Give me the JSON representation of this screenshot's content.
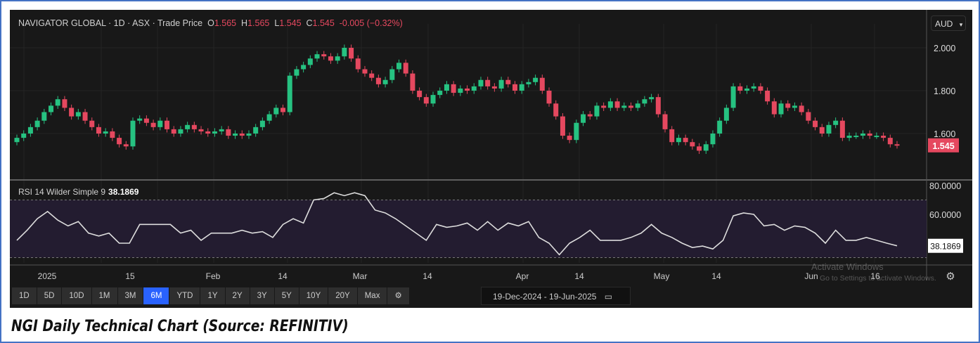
{
  "header": {
    "title": "NAVIGATOR GLOBAL · 1D · ASX · Trade Price",
    "o_label": "O",
    "o": "1.565",
    "h_label": "H",
    "h": "1.565",
    "l_label": "L",
    "l": "1.545",
    "c_label": "C",
    "c": "1.545",
    "change": "-0.005 (−0.32%)"
  },
  "currency": "AUD",
  "colors": {
    "up": "#26c281",
    "down": "#e5485f",
    "bg": "#181818",
    "active": "#2962ff"
  },
  "chart_data": [
    {
      "type": "candlestick",
      "title": "NAVIGATOR GLOBAL · 1D · ASX · Trade Price",
      "ylim": [
        1.42,
        2.08
      ],
      "y_ticks": [
        "2.000",
        "1.800",
        "1.600"
      ],
      "last_price": "1.545",
      "first_open": 1.56,
      "closes": [
        1.58,
        1.6,
        1.63,
        1.66,
        1.7,
        1.73,
        1.76,
        1.72,
        1.68,
        1.7,
        1.66,
        1.63,
        1.6,
        1.61,
        1.58,
        1.55,
        1.54,
        1.66,
        1.67,
        1.65,
        1.63,
        1.66,
        1.62,
        1.6,
        1.62,
        1.64,
        1.62,
        1.61,
        1.6,
        1.61,
        1.62,
        1.59,
        1.6,
        1.59,
        1.6,
        1.63,
        1.66,
        1.69,
        1.72,
        1.7,
        1.87,
        1.9,
        1.92,
        1.95,
        1.97,
        1.96,
        1.94,
        1.96,
        2.0,
        1.95,
        1.9,
        1.88,
        1.86,
        1.83,
        1.85,
        1.9,
        1.93,
        1.88,
        1.8,
        1.77,
        1.74,
        1.78,
        1.8,
        1.83,
        1.79,
        1.81,
        1.8,
        1.82,
        1.85,
        1.82,
        1.81,
        1.85,
        1.83,
        1.8,
        1.83,
        1.84,
        1.86,
        1.8,
        1.74,
        1.68,
        1.59,
        1.57,
        1.65,
        1.69,
        1.68,
        1.73,
        1.72,
        1.75,
        1.72,
        1.73,
        1.72,
        1.74,
        1.76,
        1.77,
        1.69,
        1.62,
        1.56,
        1.58,
        1.56,
        1.54,
        1.52,
        1.55,
        1.6,
        1.66,
        1.72,
        1.82,
        1.8,
        1.81,
        1.82,
        1.8,
        1.75,
        1.69,
        1.74,
        1.72,
        1.73,
        1.7,
        1.66,
        1.63,
        1.6,
        1.64,
        1.66,
        1.58,
        1.59,
        1.59,
        1.6,
        1.59,
        1.59,
        1.58,
        1.55,
        1.545
      ]
    },
    {
      "type": "line",
      "title": "RSI 14 Wilder Simple 9",
      "current": "38.1869",
      "ylim": [
        22,
        82
      ],
      "y_ticks": [
        "80.0000",
        "60.0000"
      ],
      "bands": [
        70,
        30
      ],
      "values": [
        42,
        49,
        57,
        62,
        56,
        52,
        55,
        47,
        45,
        47,
        40,
        40,
        53,
        53,
        53,
        53,
        47,
        49,
        42,
        47,
        47,
        47,
        49,
        47,
        48,
        44,
        53,
        57,
        54,
        70,
        71,
        75,
        73,
        75,
        73,
        63,
        61,
        57,
        52,
        47,
        42,
        53,
        51,
        52,
        54,
        49,
        55,
        49,
        54,
        52,
        55,
        44,
        40,
        32,
        40,
        44,
        49,
        42,
        42,
        42,
        44,
        47,
        53,
        47,
        44,
        40,
        37,
        38,
        36,
        42,
        59,
        61,
        60,
        52,
        53,
        49,
        52,
        51,
        47,
        40,
        49,
        42,
        42,
        44,
        42,
        40,
        38.2
      ]
    }
  ],
  "x_axis": [
    "2025",
    "15",
    "Feb",
    "14",
    "Mar",
    "14",
    "Apr",
    "14",
    "May",
    "14",
    "Jun",
    "16"
  ],
  "ranges": [
    "1D",
    "5D",
    "10D",
    "1M",
    "3M",
    "6M",
    "YTD",
    "1Y",
    "2Y",
    "3Y",
    "5Y",
    "10Y",
    "20Y",
    "Max"
  ],
  "active_range": "6M",
  "date_range": "19-Dec-2024  -  19-Jun-2025",
  "watermark": {
    "line1": "Activate Windows",
    "line2": "Go to Settings to activate Windows."
  },
  "caption": "NGI Daily Technical Chart (Source: REFINITIV)"
}
